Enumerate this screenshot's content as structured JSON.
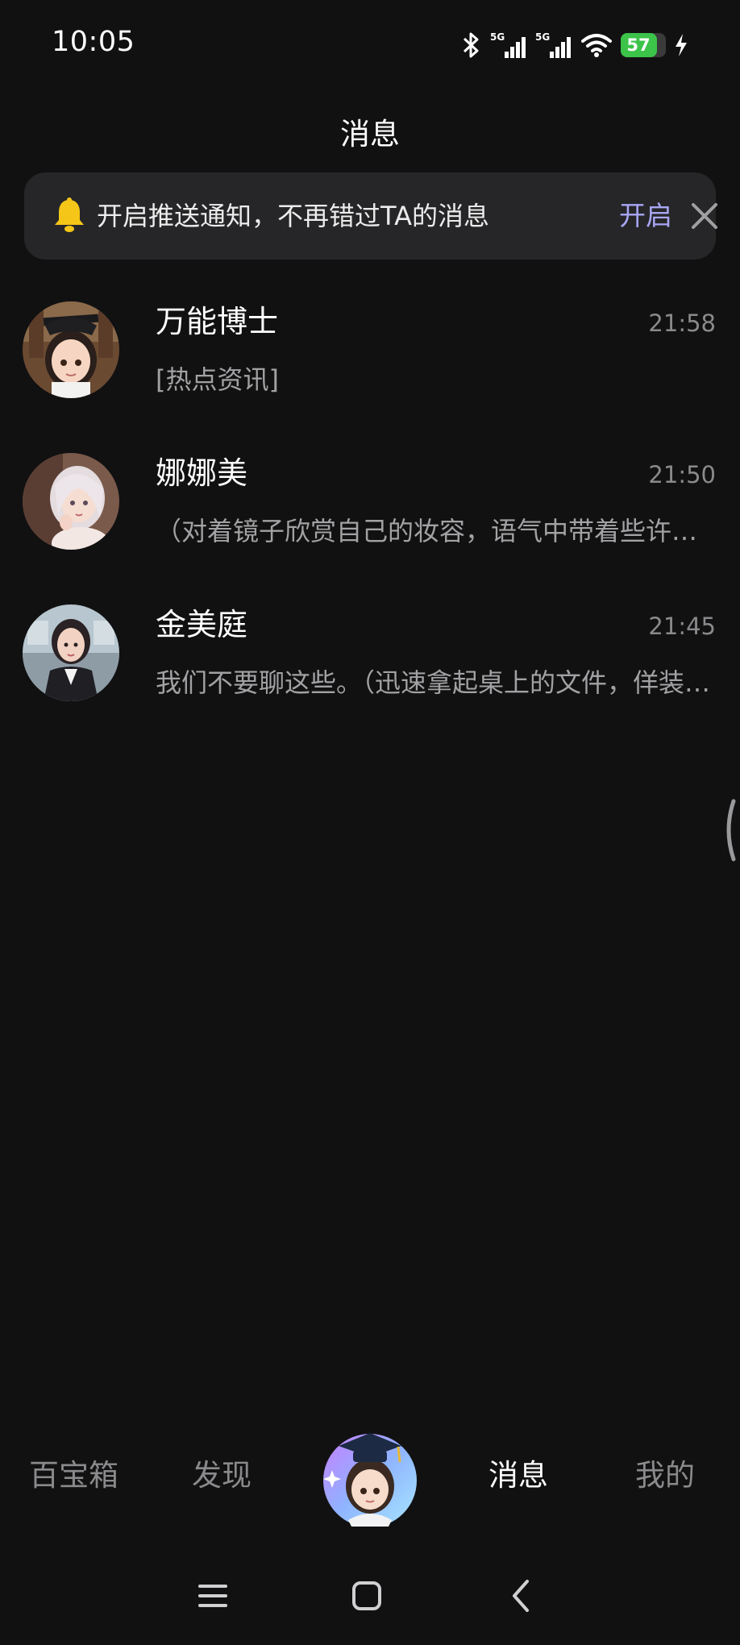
{
  "status_bar": {
    "time": "10:05",
    "network_1": "5G",
    "network_2": "5G",
    "battery_percent": "57",
    "battery_level": 0.57,
    "icons": [
      "bluetooth-icon",
      "signal-5g-icon",
      "signal-5g-icon",
      "wifi-icon",
      "battery-icon",
      "charging-icon"
    ]
  },
  "header": {
    "title": "消息"
  },
  "notice": {
    "icon": "bell-icon",
    "text": "开启推送通知，不再错过TA的消息",
    "action_label": "开启",
    "close_icon": "close-icon",
    "accent_color": "#a8a6f4"
  },
  "conversations": [
    {
      "name": "万能博士",
      "time": "21:58",
      "preview": "[热点资讯]",
      "avatar": "graduate-girl-avatar"
    },
    {
      "name": "娜娜美",
      "time": "21:50",
      "preview": "（对着镜子欣赏自己的妆容，语气中带着些许得意）",
      "avatar": "silver-hair-girl-avatar"
    },
    {
      "name": "金美庭",
      "time": "21:45",
      "preview": "我们不要聊这些。（迅速拿起桌上的文件，佯装忙碌）",
      "avatar": "office-lady-avatar"
    }
  ],
  "bottom_nav": {
    "items": [
      {
        "label": "百宝箱",
        "active": false
      },
      {
        "label": "发现",
        "active": false
      },
      {
        "label": "消息",
        "active": true
      },
      {
        "label": "我的",
        "active": false
      }
    ],
    "center_avatar": "graduate-girl-avatar"
  },
  "system_nav": {
    "icons": [
      "menu-icon",
      "home-icon",
      "back-icon"
    ]
  }
}
